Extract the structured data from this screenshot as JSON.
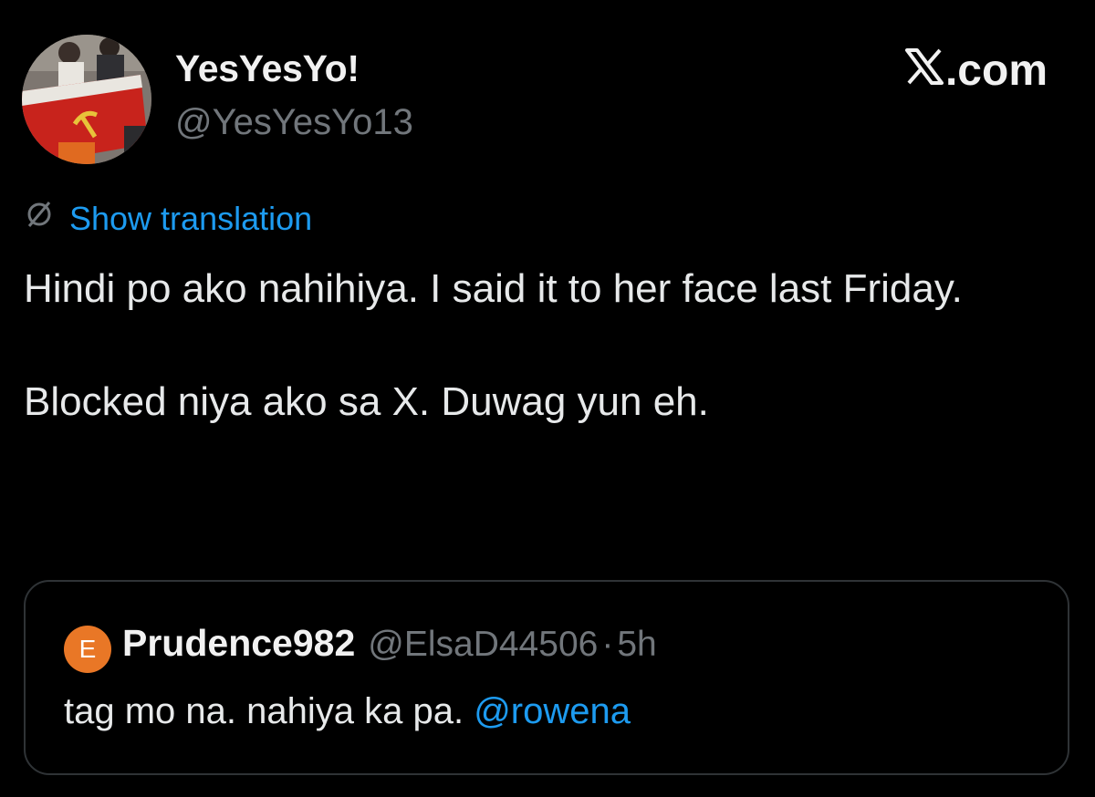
{
  "author": {
    "display_name": "YesYesYo!",
    "handle": "@YesYesYo13",
    "avatar_icon": "profile-photo-flag"
  },
  "branding": {
    "logo_icon": "x-logo-icon",
    "suffix": ".com"
  },
  "translation": {
    "icon": "globe-icon",
    "link_label": "Show translation"
  },
  "tweet": {
    "paragraphs": [
      "Hindi po ako nahihiya. I said it to her face last Friday.",
      "Blocked niya ako sa X. Duwag yun eh."
    ]
  },
  "quoted_tweet": {
    "avatar_letter": "E",
    "display_name": "Prudence982",
    "handle": "@ElsaD44506",
    "separator": "·",
    "time": "5h",
    "text": "tag mo na. nahiya ka pa.",
    "mention": "@rowena"
  },
  "colors": {
    "background": "#000000",
    "text": "#e7e9ea",
    "muted": "#71767b",
    "link": "#1d9bf0",
    "border": "#2f3336",
    "quoted_avatar": "#e97726"
  }
}
